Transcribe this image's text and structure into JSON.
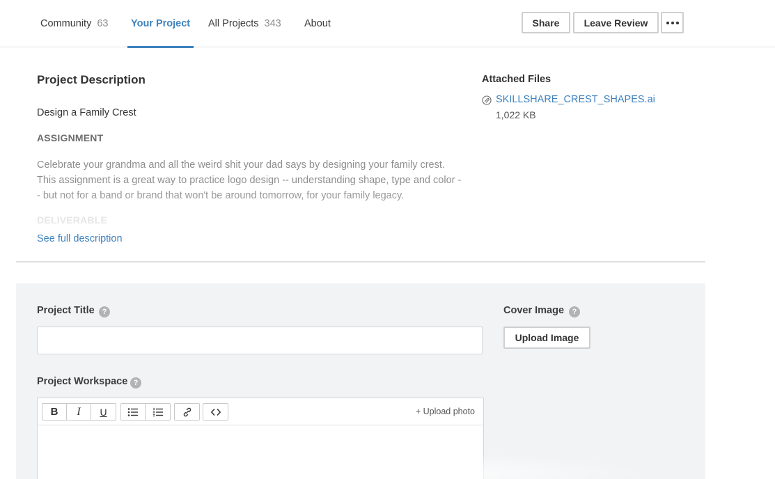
{
  "nav": {
    "tabs": [
      {
        "label": "Community",
        "count": "63"
      },
      {
        "label": "Your Project",
        "count": ""
      },
      {
        "label": "All Projects",
        "count": "343"
      },
      {
        "label": "About",
        "count": ""
      }
    ],
    "active_tab": "Your Project",
    "buttons": {
      "share": "Share",
      "leave_review": "Leave Review",
      "more": "more-horizontal-icon"
    }
  },
  "description": {
    "heading": "Project Description",
    "project_name": "Design a Family Crest",
    "assignment_label": "ASSIGNMENT",
    "assignment_text": "Celebrate your grandma and all the weird shit your dad says by designing your family crest. This assignment is a great way to practice logo design -- understanding shape, type and color -- but not for a band or brand that won't be around tomorrow, for your family legacy.",
    "deliverable_label": "DELIVERABLE",
    "see_full": "See full description"
  },
  "attached_files": {
    "heading": "Attached Files",
    "files": [
      {
        "name": "SKILLSHARE_CREST_SHAPES.ai",
        "size": "1,022 KB",
        "icon": "attachment-icon"
      }
    ]
  },
  "form": {
    "project_title_label": "Project Title",
    "project_title_value": "",
    "cover_image_label": "Cover Image",
    "upload_image": "Upload Image",
    "workspace_label": "Project Workspace",
    "help_glyph": "?",
    "upload_photo": "+ Upload photo",
    "toolbar": {
      "bold": "B",
      "italic": "I",
      "underline": "U"
    }
  },
  "colors": {
    "accent": "#3d82bf",
    "panel_bg": "#f2f3f5",
    "muted": "#8e8e8e"
  }
}
